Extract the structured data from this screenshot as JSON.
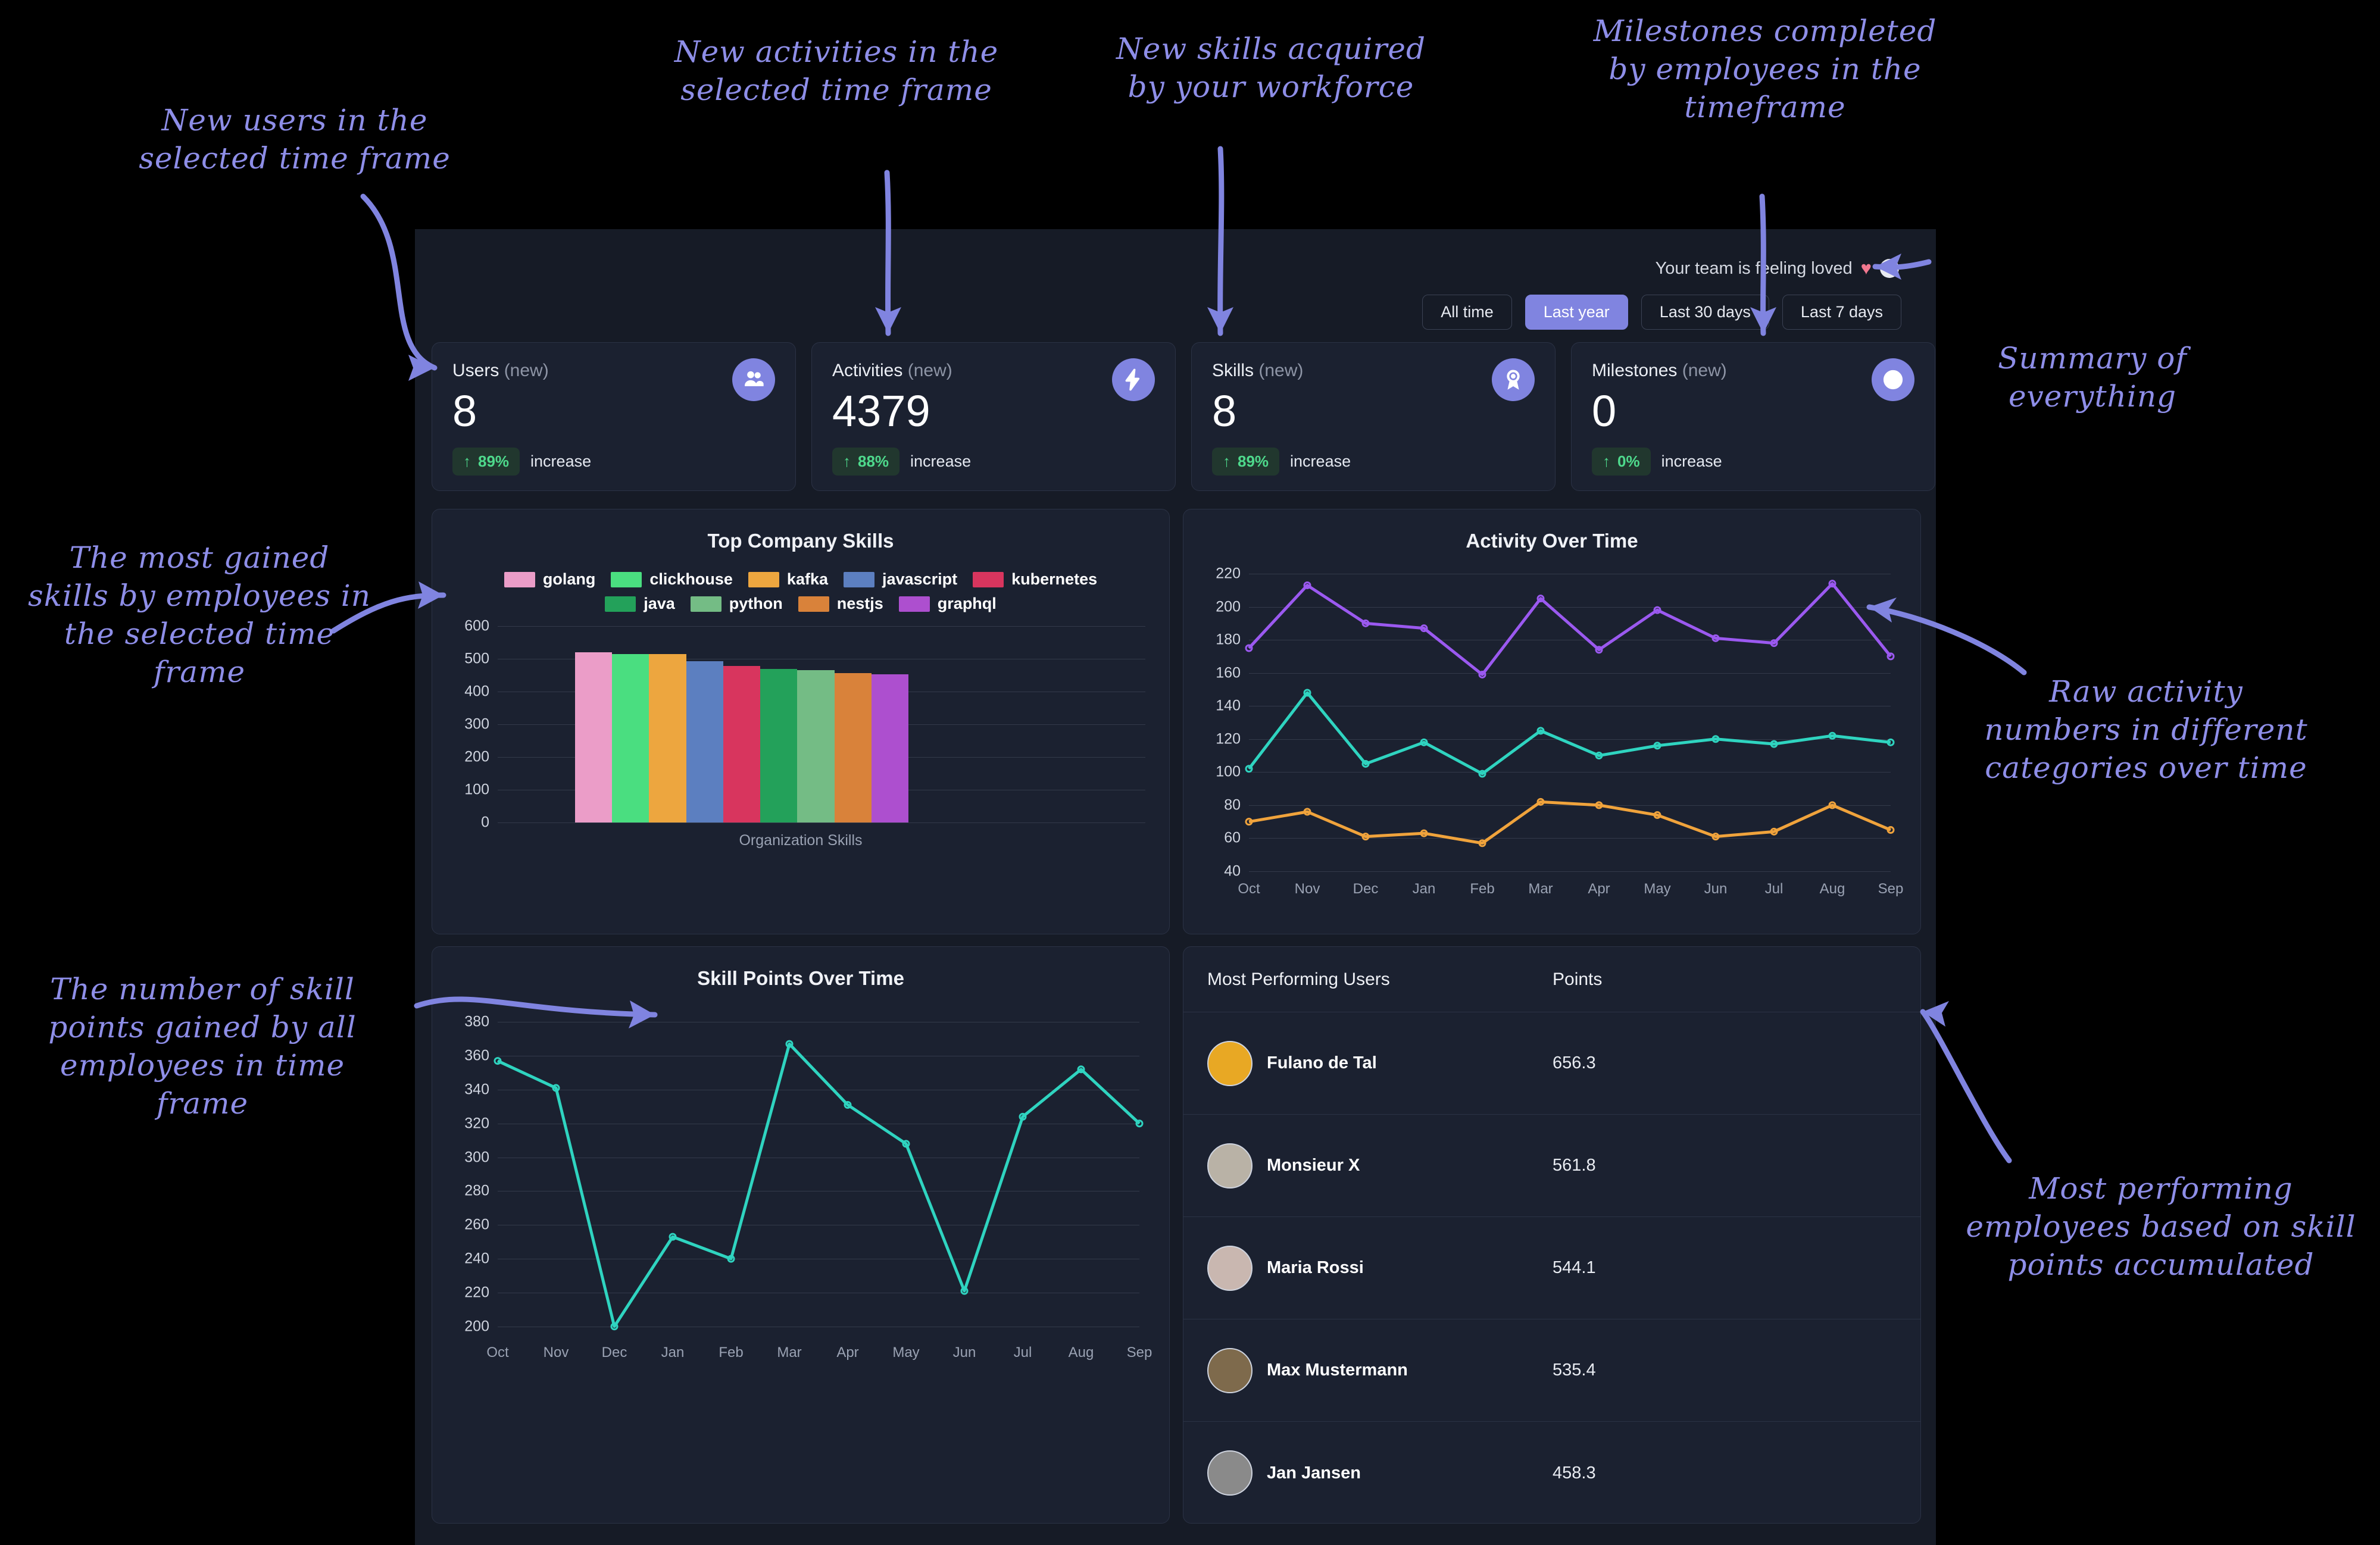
{
  "header": {
    "mood_text": "Your team is feeling loved",
    "heart_icon": "heart-icon",
    "help_icon": "question-mark-icon",
    "filters": [
      {
        "label": "All time",
        "active": false
      },
      {
        "label": "Last year",
        "active": true
      },
      {
        "label": "Last 30 days",
        "active": false
      },
      {
        "label": "Last 7 days",
        "active": false
      }
    ]
  },
  "stats": [
    {
      "title": "Users",
      "suffix": "(new)",
      "value": "8",
      "pct": "89%",
      "change_label": "increase",
      "icon": "users-icon",
      "arrow": "↑"
    },
    {
      "title": "Activities",
      "suffix": "(new)",
      "value": "4379",
      "pct": "88%",
      "change_label": "increase",
      "icon": "lightning-icon",
      "arrow": "↑"
    },
    {
      "title": "Skills",
      "suffix": "(new)",
      "value": "8",
      "pct": "89%",
      "change_label": "increase",
      "icon": "award-icon",
      "arrow": "↑"
    },
    {
      "title": "Milestones",
      "suffix": "(new)",
      "value": "0",
      "pct": "0%",
      "change_label": "increase",
      "icon": "clock-icon",
      "arrow": "↑"
    }
  ],
  "cards": {
    "skills_title": "Top Company Skills",
    "activity_title": "Activity Over Time",
    "points_title": "Skill Points Over Time",
    "users_title": "Most Performing Users",
    "points_column": "Points"
  },
  "users": [
    {
      "name": "Fulano de Tal",
      "points": "656.3",
      "avatar_color": "#e8a824"
    },
    {
      "name": "Monsieur X",
      "points": "561.8",
      "avatar_color": "#b9b2a6"
    },
    {
      "name": "Maria Rossi",
      "points": "544.1",
      "avatar_color": "#c9b7b0"
    },
    {
      "name": "Max Mustermann",
      "points": "535.4",
      "avatar_color": "#7e6a4c"
    },
    {
      "name": "Jan Jansen",
      "points": "458.3",
      "avatar_color": "#8a8a8a"
    }
  ],
  "annotations": [
    {
      "id": "a-users",
      "text": "New users in the\nselected time frame"
    },
    {
      "id": "a-activities",
      "text": "New activities in the\nselected time frame"
    },
    {
      "id": "a-skills",
      "text": "New skills acquired\nby your workforce"
    },
    {
      "id": "a-milestones",
      "text": "Milestones completed\nby employees in the\ntimeframe"
    },
    {
      "id": "a-summary",
      "text": "Summary of\neverything"
    },
    {
      "id": "a-topskills",
      "text": "The most gained\nskills by employees in\nthe selected time\nframe"
    },
    {
      "id": "a-rawactivity",
      "text": "Raw activity\nnumbers in different\ncategories over time"
    },
    {
      "id": "a-skillpoints",
      "text": "The number of skill\npoints gained by all\nemployees in time\nframe"
    },
    {
      "id": "a-performers",
      "text": "Most performing\nemployees based on skill\npoints accumulated"
    }
  ],
  "chart_data": [
    {
      "type": "bar",
      "title": "Top Company Skills",
      "xlabel": "Organization Skills",
      "ylabel": "",
      "ylim": [
        0,
        600
      ],
      "yticks": [
        0,
        100,
        200,
        300,
        400,
        500,
        600
      ],
      "grid": true,
      "legend_position": "top",
      "categories": [
        "golang",
        "clickhouse",
        "kafka",
        "javascript",
        "kubernetes",
        "java",
        "python",
        "nestjs",
        "graphql"
      ],
      "values": [
        520,
        515,
        514,
        492,
        478,
        470,
        465,
        457,
        452
      ],
      "colors": [
        "#eb9dc8",
        "#4ade80",
        "#eda63f",
        "#5c7fc0",
        "#d8355e",
        "#23a15a",
        "#74bc85",
        "#d9823a",
        "#ad4fcf"
      ]
    },
    {
      "type": "line",
      "title": "Activity Over Time",
      "xlabel": "",
      "ylabel": "",
      "ylim": [
        40,
        220
      ],
      "yticks": [
        40,
        60,
        80,
        100,
        120,
        140,
        160,
        180,
        200,
        220
      ],
      "grid": true,
      "legend_position": "none",
      "x": [
        "Oct",
        "Nov",
        "Dec",
        "Jan",
        "Feb",
        "Mar",
        "Apr",
        "May",
        "Jun",
        "Jul",
        "Aug",
        "Sep"
      ],
      "series": [
        {
          "name": "purple",
          "color": "#9b59f0",
          "values": [
            175,
            213,
            190,
            187,
            159,
            205,
            174,
            198,
            181,
            178,
            214,
            170
          ]
        },
        {
          "name": "teal",
          "color": "#2fd4c0",
          "values": [
            102,
            148,
            105,
            118,
            99,
            125,
            110,
            116,
            120,
            117,
            122,
            118
          ]
        },
        {
          "name": "orange",
          "color": "#f0a33c",
          "values": [
            70,
            76,
            61,
            63,
            57,
            82,
            80,
            74,
            61,
            64,
            80,
            65
          ]
        }
      ]
    },
    {
      "type": "line",
      "title": "Skill Points Over Time",
      "xlabel": "",
      "ylabel": "",
      "ylim": [
        195,
        385
      ],
      "yticks": [
        200,
        220,
        240,
        260,
        280,
        300,
        320,
        340,
        360,
        380
      ],
      "grid": true,
      "legend_position": "none",
      "x": [
        "Oct",
        "Nov",
        "Dec",
        "Jan",
        "Feb",
        "Mar",
        "Apr",
        "May",
        "Jun",
        "Jul",
        "Aug",
        "Sep"
      ],
      "series": [
        {
          "name": "skill points",
          "color": "#2fd4c0",
          "values": [
            357,
            341,
            200,
            253,
            240,
            367,
            331,
            308,
            221,
            324,
            352,
            320
          ]
        }
      ]
    }
  ]
}
